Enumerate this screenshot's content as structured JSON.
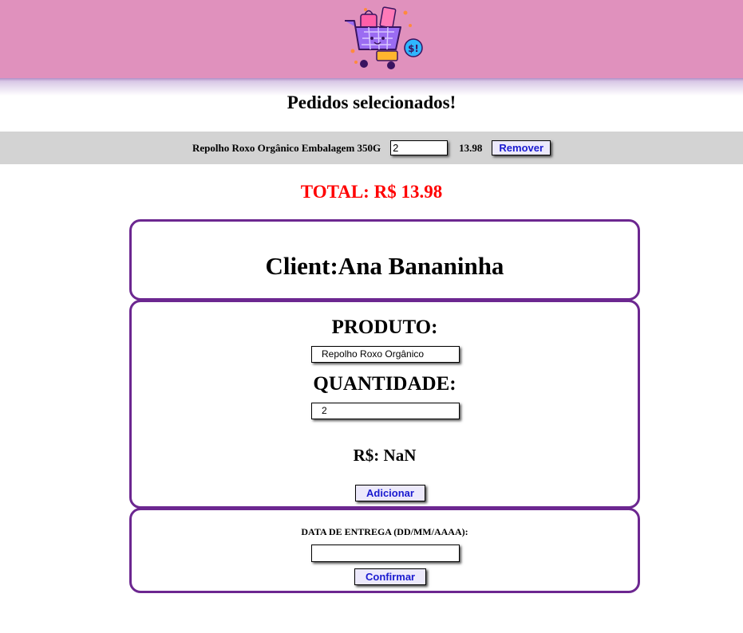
{
  "header": {
    "logo_icon": "shopping-cart-logo-icon",
    "background_color": "#e091bd"
  },
  "page_title": "Pedidos selecionados!",
  "cart": {
    "items": [
      {
        "name": "Repolho Roxo Orgânico Embalagem 350G",
        "quantity": "2",
        "price": "13.98",
        "remove_label": "Remover"
      }
    ]
  },
  "total": {
    "text": "TOTAL: R$ 13.98",
    "color": "#ff0000"
  },
  "client": {
    "text": "Client:Ana Bananinha"
  },
  "product_form": {
    "product_label": "PRODUTO:",
    "product_value": "Repolho Roxo Orgânico",
    "quantity_label": "QUANTIDADE:",
    "quantity_value": "2",
    "price_text": "R$: NaN",
    "add_label": "Adicionar"
  },
  "delivery_form": {
    "date_label": "DATA DE ENTREGA (DD/MM/AAAA):",
    "date_value": "",
    "confirm_label": "Confirmar"
  },
  "theme": {
    "border_color": "#6c2790",
    "button_text_color": "#1a1ad0"
  }
}
